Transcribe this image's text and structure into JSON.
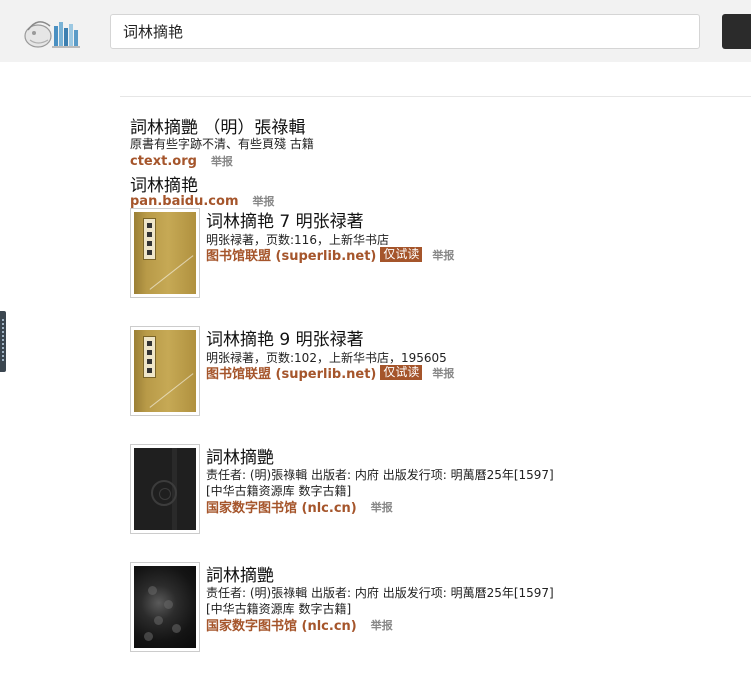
{
  "search": {
    "query": "词林摘艳",
    "button_label": ""
  },
  "results": [
    {
      "title": "詞林摘艷 （明）張祿輯",
      "desc": "原書有些字跡不清、有些頁殘 古籍",
      "source": "ctext.org",
      "report": "举报"
    },
    {
      "title": "词林摘艳",
      "source": "pan.baidu.com",
      "report": "举报"
    },
    {
      "title": "词林摘艳 7 明张禄著",
      "meta": "明张禄著，页数:116，上新华书店",
      "source": "图书馆联盟 (superlib.net)",
      "badge": "仅试读",
      "report": "举报"
    },
    {
      "title": "词林摘艳 9 明张禄著",
      "meta": "明张禄著，页数:102，上新华书店，195605",
      "source": "图书馆联盟 (superlib.net)",
      "badge": "仅试读",
      "report": "举报"
    },
    {
      "title": "詞林摘艷",
      "meta": "责任者: (明)張祿輯 出版者: 内府 出版发行项: 明萬曆25年[1597]",
      "collection": "[中华古籍资源库 数字古籍]",
      "source": "国家数字图书馆 (nlc.cn)",
      "report": "举报"
    },
    {
      "title": "詞林摘艷",
      "meta": "责任者: (明)張祿輯 出版者: 内府 出版发行项: 明萬曆25年[1597]",
      "collection": "[中华古籍资源库 数字古籍]",
      "source": "国家数字图书馆 (nlc.cn)",
      "report": "举报"
    }
  ],
  "colors": {
    "source": "#a5552b",
    "badge_bg": "#a5552b",
    "header_bg": "#f2f2f2",
    "report": "#888888"
  },
  "icons": {
    "logo": "books-logo-icon",
    "search_button": "search-button"
  }
}
